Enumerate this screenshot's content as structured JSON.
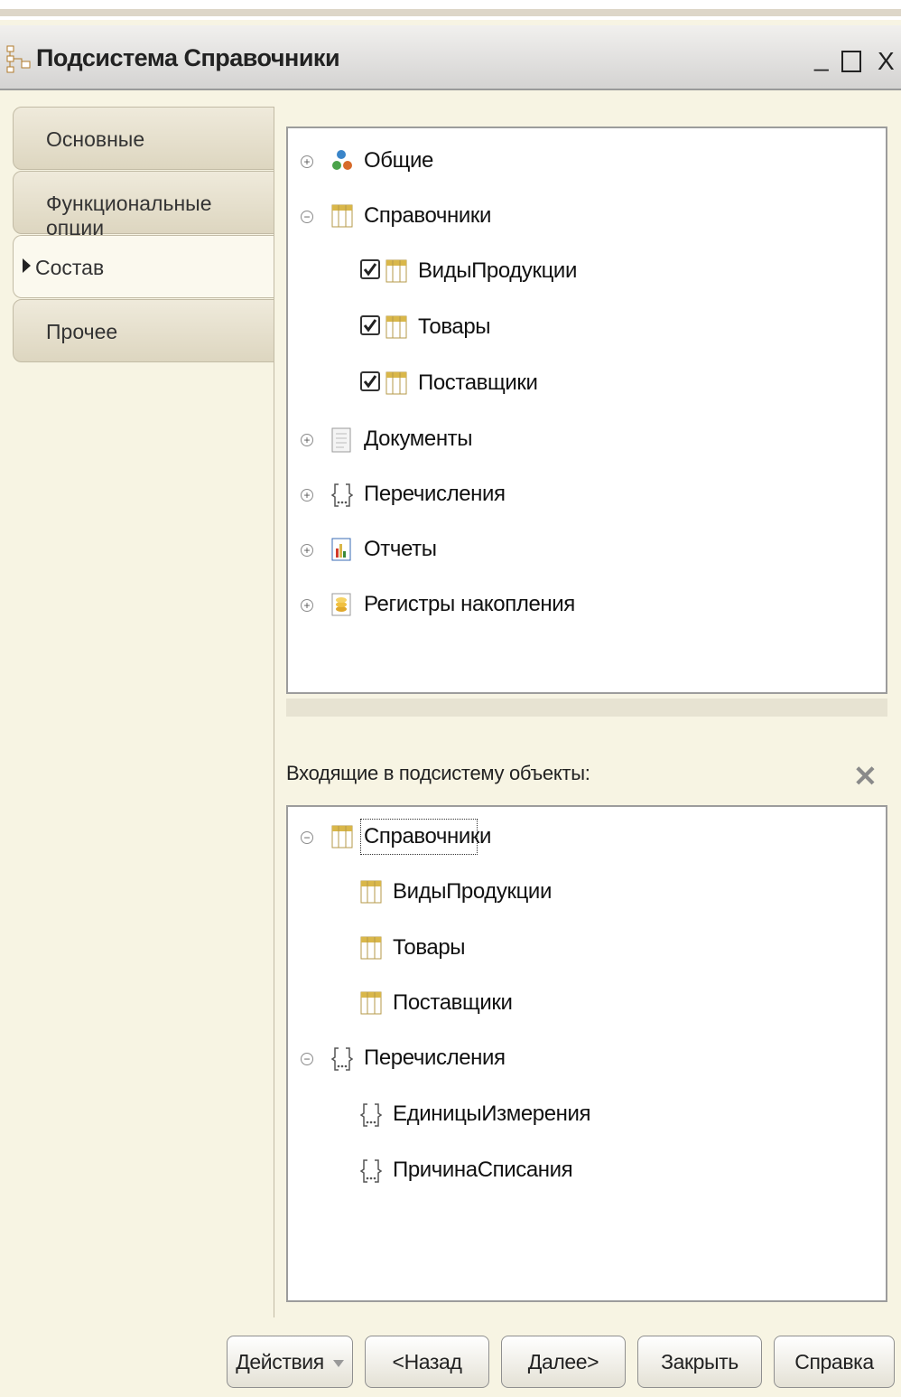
{
  "window": {
    "title": "Подсистема Справочники",
    "minimize": "_",
    "close": "X"
  },
  "tabs": [
    {
      "label": "Основные",
      "active": false
    },
    {
      "label": "Функциональные опции",
      "active": false
    },
    {
      "label": "Состав",
      "active": true
    },
    {
      "label": "Прочее",
      "active": false
    }
  ],
  "tree": {
    "items": [
      {
        "label": "Общие",
        "icon": "common-objects-icon",
        "expander": "plus"
      },
      {
        "label": "Справочники",
        "icon": "catalog-icon",
        "expander": "minus"
      },
      {
        "label": "ВидыПродукции",
        "icon": "catalog-icon",
        "checked": true
      },
      {
        "label": "Товары",
        "icon": "catalog-icon",
        "checked": true
      },
      {
        "label": "Поставщики",
        "icon": "catalog-icon",
        "checked": true
      },
      {
        "label": "Документы",
        "icon": "document-icon",
        "expander": "plus"
      },
      {
        "label": "Перечисления",
        "icon": "enum-icon",
        "expander": "plus"
      },
      {
        "label": "Отчеты",
        "icon": "report-icon",
        "expander": "plus"
      },
      {
        "label": "Регистры накопления",
        "icon": "accumulation-register-icon",
        "expander": "plus"
      }
    ]
  },
  "included": {
    "label": "Входящие в подсистему объекты:",
    "remove_icon": "remove-icon",
    "items": [
      {
        "label": "Справочники",
        "icon": "catalog-icon",
        "expander": "minus"
      },
      {
        "label": "ВидыПродукции",
        "icon": "catalog-icon"
      },
      {
        "label": "Товары",
        "icon": "catalog-icon"
      },
      {
        "label": "Поставщики",
        "icon": "catalog-icon"
      },
      {
        "label": "Перечисления",
        "icon": "enum-icon",
        "expander": "minus"
      },
      {
        "label": "ЕдиницыИзмерения",
        "icon": "enum-icon"
      },
      {
        "label": "ПричинаСписания",
        "icon": "enum-icon"
      }
    ]
  },
  "buttons": {
    "actions": "Действия",
    "back": "<Назад",
    "next": "Далее>",
    "close": "Закрыть",
    "help": "Справка"
  },
  "colors": {
    "window_bg": "#f7f4e3",
    "panel_border": "#9c9c9c",
    "catalog_icon": "#d9b74a"
  }
}
